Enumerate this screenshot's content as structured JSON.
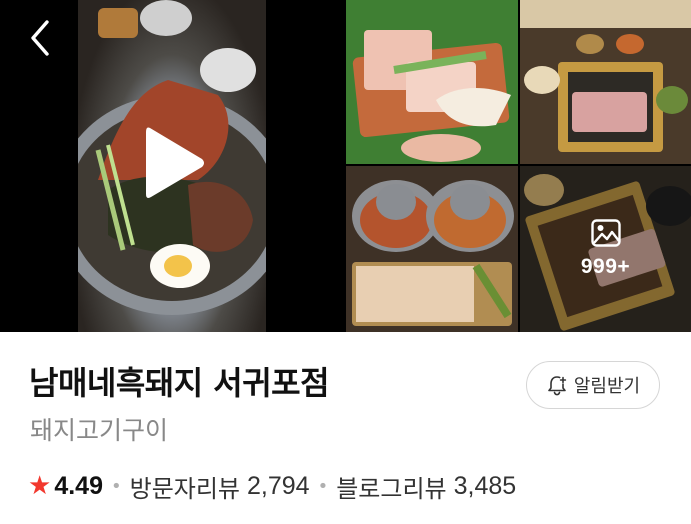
{
  "place": {
    "name": "남매네흑돼지 서귀포점",
    "category": "돼지고기구이"
  },
  "gallery": {
    "more_count": "999+",
    "icons": {
      "back": "chevron-left-icon",
      "play": "play-icon",
      "gallery": "image-icon"
    }
  },
  "alert_button": {
    "label": "알림받기",
    "icon": "bell-plus-icon"
  },
  "rating": {
    "value": "4.49",
    "star_color": "#f2382e"
  },
  "reviews": {
    "visitor_label": "방문자리뷰",
    "visitor_count": "2,794",
    "blog_label": "블로그리뷰",
    "blog_count": "3,485"
  }
}
